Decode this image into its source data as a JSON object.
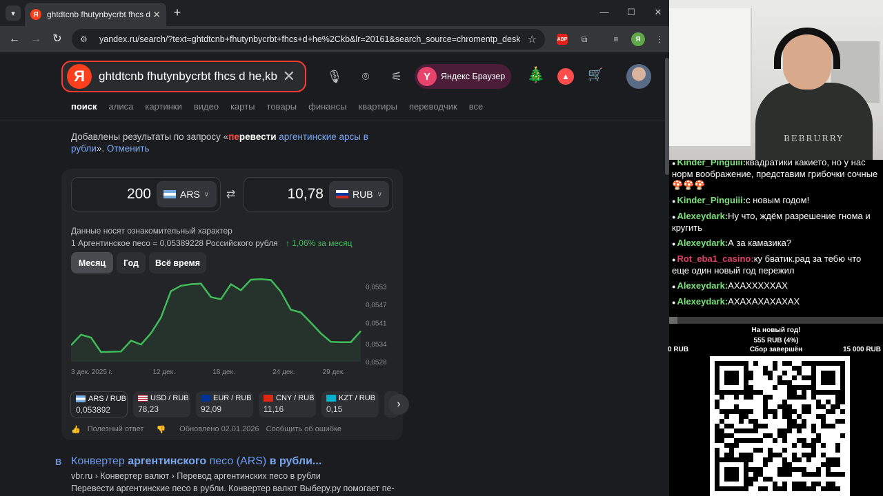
{
  "browser": {
    "tab": {
      "title": "ghtdtcnb fhutynbycrbt fhcs d he,kb",
      "favicon": "Я"
    },
    "url": "yandex.ru/search/?text=ghtdtcnb+fhutynbycrbt+fhcs+d+he%2Ckb&lr=20161&search_source=chromentp_deskt...",
    "profile_letter": "Я",
    "abp_label": "ABP"
  },
  "yandex": {
    "logo": "Я",
    "query": "ghtdtcnb fhutynbycrbt fhcs d he,kb",
    "browser_button": {
      "logo": "Y",
      "label": "Яндекс Браузер"
    },
    "nav_tabs": [
      "поиск",
      "алиса",
      "картинки",
      "видео",
      "карты",
      "товары",
      "финансы",
      "квартиры",
      "переводчик",
      "все"
    ],
    "notice": {
      "prefix": "Добавлены результаты по запросу «",
      "query_red": "пе",
      "query_rest_bold": "ревести",
      "query_tail": " аргентинские арсы в рубли",
      "suffix": "». ",
      "cancel": "Отменить"
    },
    "converter": {
      "from_amount": "200",
      "from_currency": "ARS",
      "to_amount": "10,78",
      "to_currency": "RUB",
      "disclaimer": "Данные носят ознакомительный характер",
      "rate_text": "1 Аргентинское песо = 0,05389228 Российского рубля",
      "change_text": "↑ 1,06%  за месяц",
      "periods": [
        "Месяц",
        "Год",
        "Всё время"
      ],
      "pairs": [
        {
          "name": "ARS / RUB",
          "value": "0,053892",
          "flag": "ar"
        },
        {
          "name": "USD / RUB",
          "value": "78,23",
          "flag": "us"
        },
        {
          "name": "EUR / RUB",
          "value": "92,09",
          "flag": "eu"
        },
        {
          "name": "CNY / RUB",
          "value": "11,16",
          "flag": "cn"
        },
        {
          "name": "KZT / RUB",
          "value": "0,15",
          "flag": "kz"
        }
      ],
      "footer": {
        "useful": "Полезный ответ",
        "updated": "Обновлено 02.01.2026",
        "report": "Сообщить об ошибке"
      }
    },
    "result": {
      "favicon": "B",
      "title_plain_1": "Конвертер ",
      "title_bold_1": "аргентинского",
      "title_plain_2": " песо (ARS) ",
      "title_bold_2": "в рубли",
      "title_tail": "...",
      "breadcrumb": "vbr.ru › Конвертер валют › Перевод аргентинских песо в рубли",
      "snippet": "Перевести аргентинские песо в рубли. Конвертер валют Выберу.ру помогает пе-"
    }
  },
  "chart_data": {
    "type": "area",
    "x": [
      "3 дек.",
      "4 дек.",
      "5 дек.",
      "6 дек.",
      "7 дек.",
      "8 дек.",
      "9 дек.",
      "10 дек.",
      "11 дек.",
      "12 дек.",
      "13 дек.",
      "14 дек.",
      "15 дек.",
      "16 дек.",
      "17 дек.",
      "18 дек.",
      "19 дек.",
      "20 дек.",
      "21 дек.",
      "22 дек.",
      "23 дек.",
      "24 дек.",
      "25 дек.",
      "26 дек.",
      "27 дек.",
      "28 дек.",
      "29 дек.",
      "30 дек.",
      "31 дек.",
      "1 янв."
    ],
    "values": [
      0.05335,
      0.0537,
      0.0536,
      0.05312,
      0.05313,
      0.05314,
      0.0535,
      0.05337,
      0.05375,
      0.05427,
      0.05515,
      0.05533,
      0.05538,
      0.0554,
      0.05495,
      0.05488,
      0.05538,
      0.05518,
      0.05553,
      0.05555,
      0.05552,
      0.05513,
      0.05453,
      0.05444,
      0.0541,
      0.05374,
      0.05346,
      0.05345,
      0.05345,
      0.05382
    ],
    "x_ticks": [
      "3 дек. 2025 г.",
      "12 дек.",
      "18 дек.",
      "24 дек.",
      "29 дек."
    ],
    "y_ticks": [
      "0,0553",
      "0,0547",
      "0,0541",
      "0,0534",
      "0,0528"
    ],
    "ylim": [
      0.0528,
      0.0556
    ],
    "series_color": "#3fbd59"
  },
  "stream": {
    "shirt_text": "BEBRURRY",
    "chat": [
      {
        "user": "Kinder_Pinguiii:",
        "text": "квадратики какието, но у нас норм воображение, представим грибочки сочные 🍄🍄🍄",
        "color": "green"
      },
      {
        "user": "Kinder_Pinguiii:",
        "text": "с новым годом!",
        "color": "green"
      },
      {
        "user": "Alexeydark:",
        "text": "Ну что, ждём разрешение гнома и кругить",
        "color": "green"
      },
      {
        "user": "Alexeydark:",
        "text": "А за камазика?",
        "color": "green"
      },
      {
        "user": "Rot_eba1_casino:",
        "text": "ку бватик.рад за тебю что еще один новый год пережил",
        "color": "red"
      },
      {
        "user": "Alexeydark:",
        "text": "АХАХХХХХАХ",
        "color": "green"
      },
      {
        "user": "Alexeydark:",
        "text": "АХАХАХАХАХАХ",
        "color": "green"
      }
    ],
    "goal": {
      "title": "На новый год!",
      "amount": "555 RUB (4%)",
      "progress": 0.04,
      "min": "0 RUB",
      "status": "Сбор завершён",
      "max": "15 000 RUB"
    }
  }
}
